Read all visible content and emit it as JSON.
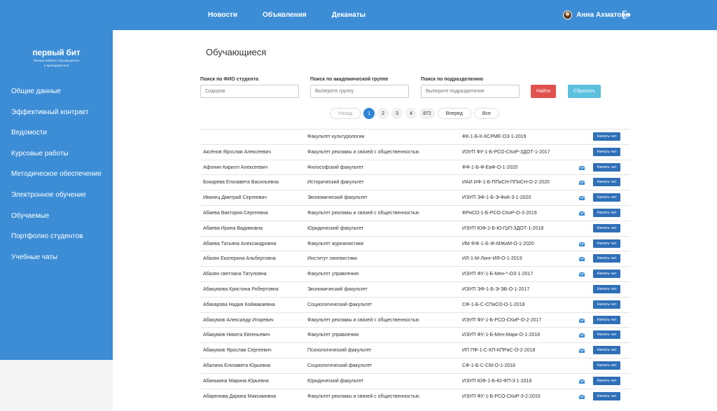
{
  "nav": {
    "items": [
      "Новости",
      "Объявления",
      "Деканаты"
    ]
  },
  "user": {
    "name": "Анна Ахматова"
  },
  "logo": {
    "main": "первый бит",
    "sub1": "Личный кабинет обучающегося",
    "sub2": "и преподавателя"
  },
  "sidebar": {
    "items": [
      "Общие данные",
      "Эффективный контракт",
      "Ведомости",
      "Курсовые работы",
      "Методическое обеспечение",
      "Электронное обучение",
      "Обучаемые",
      "Портфолио студентов",
      "Учебные чаты"
    ]
  },
  "page": {
    "title": "Обучающиеся"
  },
  "filters": {
    "fio_label": "Поиск по ФИО студента",
    "fio_placeholder": "Сидоров",
    "group_label": "Поиск по академической группе",
    "group_placeholder": "Выберите группу",
    "dept_label": "Поиск по подразделению",
    "dept_placeholder": "Выберите подразделение",
    "find": "Найти",
    "reset": "Сбросить"
  },
  "pager": {
    "prev": "Назад",
    "pages": [
      "1",
      "2",
      "3",
      "4",
      "872"
    ],
    "next": "Вперед",
    "all": "Все",
    "current": "1"
  },
  "table": {
    "chat_label": "Начать чат",
    "rows": [
      {
        "name": "",
        "faculty": "Факультет культурологии",
        "group": "ФК-1-Б-К-КСРМЕ-ОЗ-1-2019",
        "mail": false
      },
      {
        "name": "Аксёнов Ярослав Алексеевич",
        "faculty": "Факультет рекламы и связей с общественностью",
        "group": "ИЗУП ФУ-1-Б-РСО-СКиР-ЗДОТ-1-2017",
        "mail": false
      },
      {
        "name": "Афонин Кирилл Алексеевич",
        "faculty": "Философский факультет",
        "group": "ФФ-1-Б-Ф-ЕвФ-О-1-2020",
        "mail": true
      },
      {
        "name": "Бокарева Елизавета Васильевна",
        "faculty": "Исторический факультет",
        "group": "ИАИ ИФ-1-Б-ППиСН-ППиСН-О-2-2020",
        "mail": true
      },
      {
        "name": "Иванец Дмитрий Сергеевич",
        "faculty": "Экономический факультет",
        "group": "ИЭУП ЭФ-1-Б-Э-ФиК-3-1-2020",
        "mail": true
      },
      {
        "name": "Абаева Виктория Сергеевна",
        "faculty": "Факультет рекламы и связей с общественностью",
        "group": "ФРиСО-1-Б-РСО-СКиР-О-3-2019",
        "mail": true
      },
      {
        "name": "Абаева Ирина Вадимовна",
        "faculty": "Юридический факультет",
        "group": "ИЭУП ЮФ-2-Б-Ю-ГрП-ЗДОТ-1-2018",
        "mail": false
      },
      {
        "name": "Абаева Татьяна Александровна",
        "faculty": "Факультет журналистики",
        "group": "ИМ ФЖ-1-Б-Ж-МЖиМ-О-1-2020",
        "mail": true
      },
      {
        "name": "Абазян Екатерина Альбертовна",
        "faculty": "Институт лингвистики",
        "group": "ИЛ-1-М-Линг-ИЯ-О-1-2019",
        "mail": true
      },
      {
        "name": "Абазян светлана Татуловна",
        "faculty": "Факультет управления",
        "group": "ИЭУП ФУ-1-Б-Мен-*-ОЗ-1-2017",
        "mail": true
      },
      {
        "name": "Абакумова Кристина Робертовна",
        "faculty": "Экономический факультет",
        "group": "ИЭУП ЭФ-1-Б-Э-ЭБ-О-1-2017",
        "mail": false
      },
      {
        "name": "Абакарова Надия Коймакаевна",
        "faculty": "Социологический факультет",
        "group": "СФ-1-Б-С-СПиСО-О-1-2018",
        "mail": false
      },
      {
        "name": "Абакумов Александр Игоревич",
        "faculty": "Факультет рекламы и связей с общественностью",
        "group": "ИЭУП ФУ-1-Б-РСО-СКиР-О-2-2017",
        "mail": true
      },
      {
        "name": "Абакумов Никита Евгеньевич",
        "faculty": "Факультет управления",
        "group": "ИЭУП ФУ-1-Б-Мен-Марк-О-1-2018",
        "mail": true
      },
      {
        "name": "Абакумов Ярослав Сергеевич",
        "faculty": "Психологический факультет",
        "group": "ИП ПФ-1-С-КП-КПРиС-О-2-2018",
        "mail": true
      },
      {
        "name": "Абалина Елизавета Юрьевна",
        "faculty": "Социологический факультет",
        "group": "СФ-1-Б-С-СМ-О-1-2018",
        "mail": false
      },
      {
        "name": "Абанькина Марина Юрьевна",
        "faculty": "Юридический факультет",
        "group": "ИЭУП ЮФ-1-Б-Ю-ФП-3-1-2016",
        "mail": true
      },
      {
        "name": "Абаренова Дарина Максимовна",
        "faculty": "Факультет рекламы и связей с общественностью",
        "group": "ИЭУП ФУ-1-Б-РСО-СКиР-3-2-2016",
        "mail": true
      }
    ]
  },
  "colors": {
    "brand": "#3c8dd6",
    "find": "#e0524d",
    "reset": "#5bc0de",
    "chat": "#2f6fb8"
  }
}
